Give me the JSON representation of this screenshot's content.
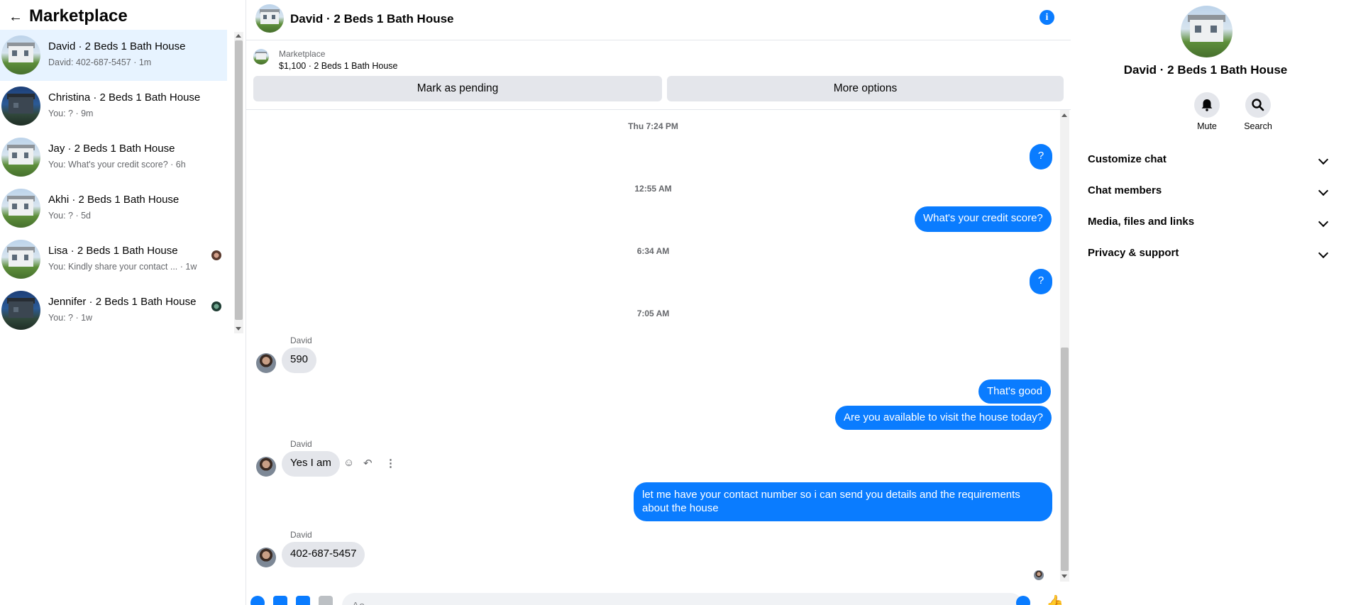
{
  "sidebar": {
    "title": "Marketplace",
    "conversations": [
      {
        "name": "David · 2 Beds 1 Bath House",
        "snippet": "David: 402-687-5457 · 1m",
        "active": true
      },
      {
        "name": "Christina · 2 Beds 1 Bath House",
        "snippet": "You: ? · 9m",
        "active": false
      },
      {
        "name": "Jay · 2 Beds 1 Bath House",
        "snippet": "You: What's your credit score? · 6h",
        "active": false
      },
      {
        "name": "Akhi · 2 Beds 1 Bath House",
        "snippet": "You: ? · 5d",
        "active": false
      },
      {
        "name": "Lisa · 2 Beds 1 Bath House",
        "snippet": "You: Kindly share your contact ... · 1w",
        "active": false
      },
      {
        "name": "Jennifer · 2 Beds 1 Bath House",
        "snippet": "You: ? · 1w",
        "active": false
      }
    ]
  },
  "chat": {
    "title": "David · 2 Beds 1 Bath House",
    "listing": {
      "label": "Marketplace",
      "title": "$1,100 · 2 Beds 1 Bath House",
      "mark_pending": "Mark as pending",
      "more_options": "More options"
    },
    "timestamps": [
      "Thu 7:24 PM",
      "12:55 AM",
      "6:34 AM",
      "7:05 AM"
    ],
    "messages": [
      {
        "from": "me",
        "text": "?"
      },
      {
        "from": "me",
        "text": "What's your credit score?"
      },
      {
        "from": "me",
        "text": "?"
      },
      {
        "from": "David",
        "text": "590"
      },
      {
        "from": "me",
        "text": "That's good"
      },
      {
        "from": "me",
        "text": "Are you available to visit the house today?"
      },
      {
        "from": "David",
        "text": "Yes I am"
      },
      {
        "from": "me",
        "text": "let me have your contact number so i can send you details and the requirements about the house"
      },
      {
        "from": "David",
        "text": "402-687-5457"
      }
    ],
    "sender_name": "David",
    "composer_placeholder": "Aa"
  },
  "right_panel": {
    "title": "David · 2 Beds 1 Bath House",
    "mute_label": "Mute",
    "search_label": "Search",
    "sections": [
      "Customize chat",
      "Chat members",
      "Media, files and links",
      "Privacy & support"
    ]
  },
  "colors": {
    "accent": "#0a7cff",
    "active_bg": "#e7f3ff",
    "bubble_in": "#e4e6eb"
  }
}
